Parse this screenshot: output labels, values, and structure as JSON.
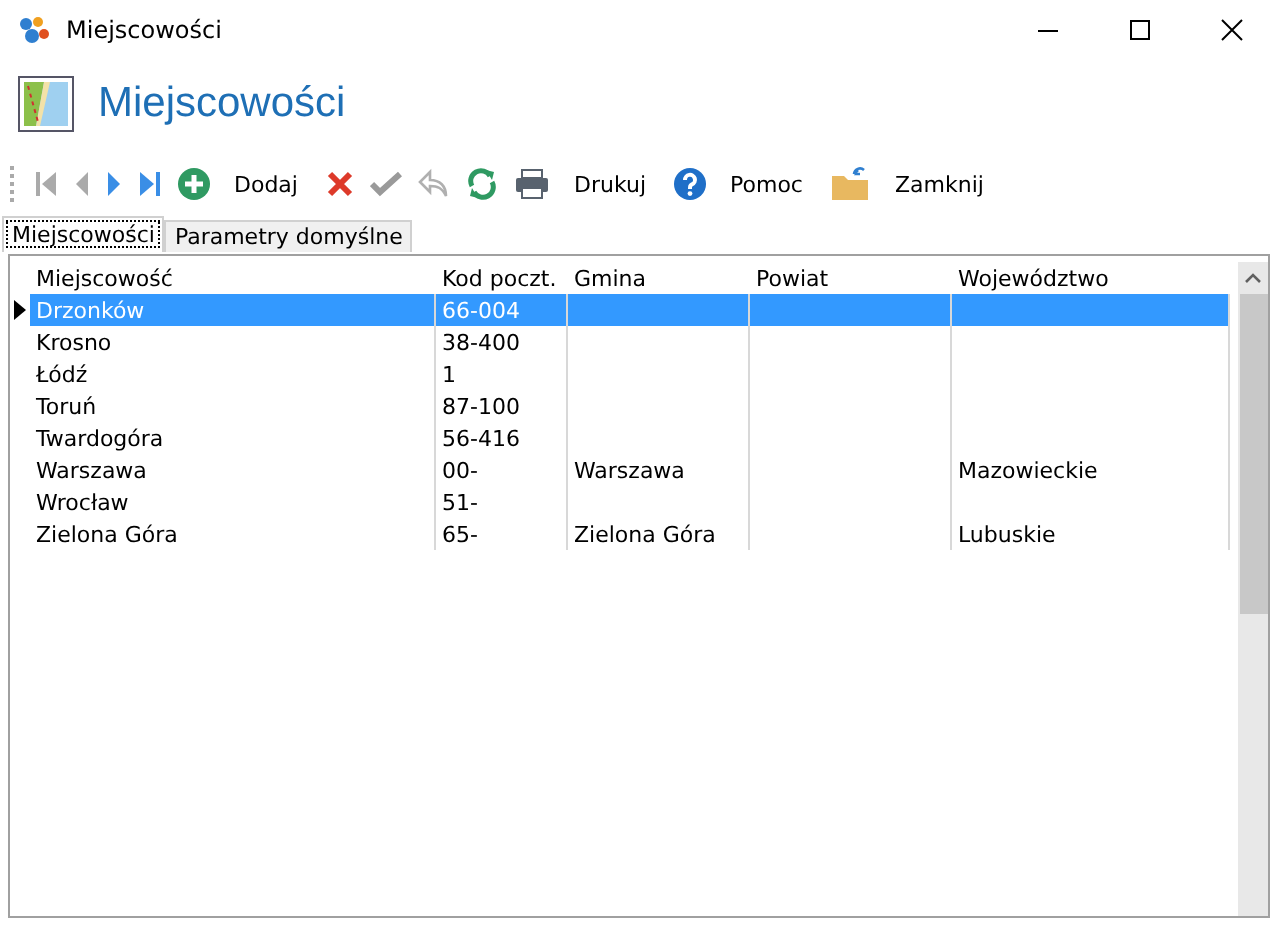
{
  "window": {
    "title": "Miejscowości"
  },
  "header": {
    "title": "Miejscowości"
  },
  "toolbar": [
    {
      "kind": "first",
      "disabled": true
    },
    {
      "kind": "prev",
      "disabled": true
    },
    {
      "kind": "next",
      "disabled": false
    },
    {
      "kind": "last",
      "disabled": false
    },
    {
      "kind": "add",
      "disabled": false,
      "label": "Dodaj"
    },
    {
      "kind": "delete",
      "disabled": false
    },
    {
      "kind": "confirm",
      "disabled": true
    },
    {
      "kind": "undo",
      "disabled": true
    },
    {
      "kind": "refresh",
      "disabled": false
    },
    {
      "kind": "print",
      "disabled": false,
      "label": "Drukuj"
    },
    {
      "kind": "help",
      "disabled": false,
      "label": "Pomoc"
    },
    {
      "kind": "close",
      "disabled": false,
      "label": "Zamknij"
    }
  ],
  "tabs": [
    {
      "label": "Miejscowości",
      "selected": true
    },
    {
      "label": "Parametry domyślne",
      "selected": false
    }
  ],
  "table": {
    "columns": [
      "Miejscowość",
      "Kod poczt.",
      "Gmina",
      "Powiat",
      "Województwo"
    ],
    "rows": [
      {
        "selected": true,
        "cells": [
          "Drzonków",
          "66-004",
          null,
          null,
          null
        ]
      },
      {
        "selected": false,
        "cells": [
          "Krosno",
          "38-400",
          null,
          null,
          null
        ]
      },
      {
        "selected": false,
        "cells": [
          "Łódź",
          "1",
          null,
          null,
          null
        ]
      },
      {
        "selected": false,
        "cells": [
          "Toruń",
          "87-100",
          null,
          null,
          null
        ]
      },
      {
        "selected": false,
        "cells": [
          "Twardogóra",
          "56-416",
          null,
          null,
          null
        ]
      },
      {
        "selected": false,
        "cells": [
          "Warszawa",
          "00-",
          "Warszawa",
          null,
          "Mazowieckie"
        ]
      },
      {
        "selected": false,
        "cells": [
          "Wrocław",
          "51-",
          null,
          null,
          null
        ]
      },
      {
        "selected": false,
        "cells": [
          "Zielona Góra",
          "65-",
          "Zielona Góra",
          null,
          "Lubuskie"
        ]
      }
    ]
  }
}
